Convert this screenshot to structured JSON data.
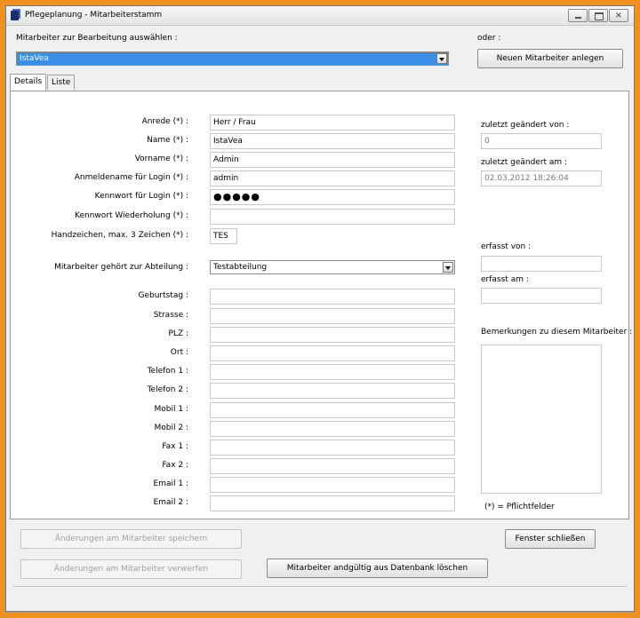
{
  "window": {
    "title": "Pflegeplanung - Mitarbeiterstamm",
    "controls": {
      "minimize_icon": "minimize-icon",
      "maximize_icon": "maximize-icon",
      "close_glyph": "×"
    }
  },
  "selector": {
    "label": "Mitarbeiter zur Bearbeitung auswählen :",
    "selected": "IstaVea",
    "or_label": "oder :",
    "new_button": "Neuen Mitarbeiter anlegen"
  },
  "tabs": [
    "Details",
    "Liste"
  ],
  "form": {
    "anrede": {
      "label": "Anrede (*) :",
      "value": "Herr / Frau"
    },
    "name": {
      "label": "Name (*) :",
      "value": "IstaVea"
    },
    "vorname": {
      "label": "Vorname (*) :",
      "value": "Admin"
    },
    "login": {
      "label": "Anmeldename für Login (*) :",
      "value": "admin"
    },
    "password": {
      "label": "Kennwort für Login (*) :",
      "value": "●●●●●"
    },
    "password_repeat": {
      "label": "Kennwort Wiederholung (*) :",
      "value": ""
    },
    "initials": {
      "label": "Handzeichen, max. 3 Zeichen (*) :",
      "value": "TES"
    },
    "department": {
      "label": "Mitarbeiter gehört zur Abteilung :",
      "value": "Testabteilung"
    },
    "geburtstag": {
      "label": "Geburtstag :",
      "value": ""
    },
    "strasse": {
      "label": "Strasse :",
      "value": ""
    },
    "plz": {
      "label": "PLZ :",
      "value": ""
    },
    "ort": {
      "label": "Ort :",
      "value": ""
    },
    "telefon1": {
      "label": "Telefon 1 :",
      "value": ""
    },
    "telefon2": {
      "label": "Telefon 2 :",
      "value": ""
    },
    "mobil1": {
      "label": "Mobil 1 :",
      "value": ""
    },
    "mobil2": {
      "label": "Mobil 2 :",
      "value": ""
    },
    "fax1": {
      "label": "Fax 1 :",
      "value": ""
    },
    "fax2": {
      "label": "Fax 2 :",
      "value": ""
    },
    "email1": {
      "label": "Email 1 :",
      "value": ""
    },
    "email2": {
      "label": "Email 2 :",
      "value": ""
    }
  },
  "audit": {
    "changed_by_label": "zuletzt geändert von :",
    "changed_by": "0",
    "changed_at_label": "zuletzt geändert am :",
    "changed_at": "02.03.2012 18:26:04",
    "created_by_label": "erfasst von :",
    "created_by": "",
    "created_at_label": "erfasst am :",
    "created_at": "",
    "remarks_label": "Bemerkungen zu diesem Mitarbeiter :",
    "remarks": "",
    "required_note": "(*) = Pflichtfelder"
  },
  "actions": {
    "save": "Änderungen am Mitarbeiter speichern",
    "discard": "Änderungen am Mitarbeiter verwerfen",
    "close": "Fenster schließen",
    "delete": "Mitarbeiter andgültig aus Datenbank löschen"
  }
}
